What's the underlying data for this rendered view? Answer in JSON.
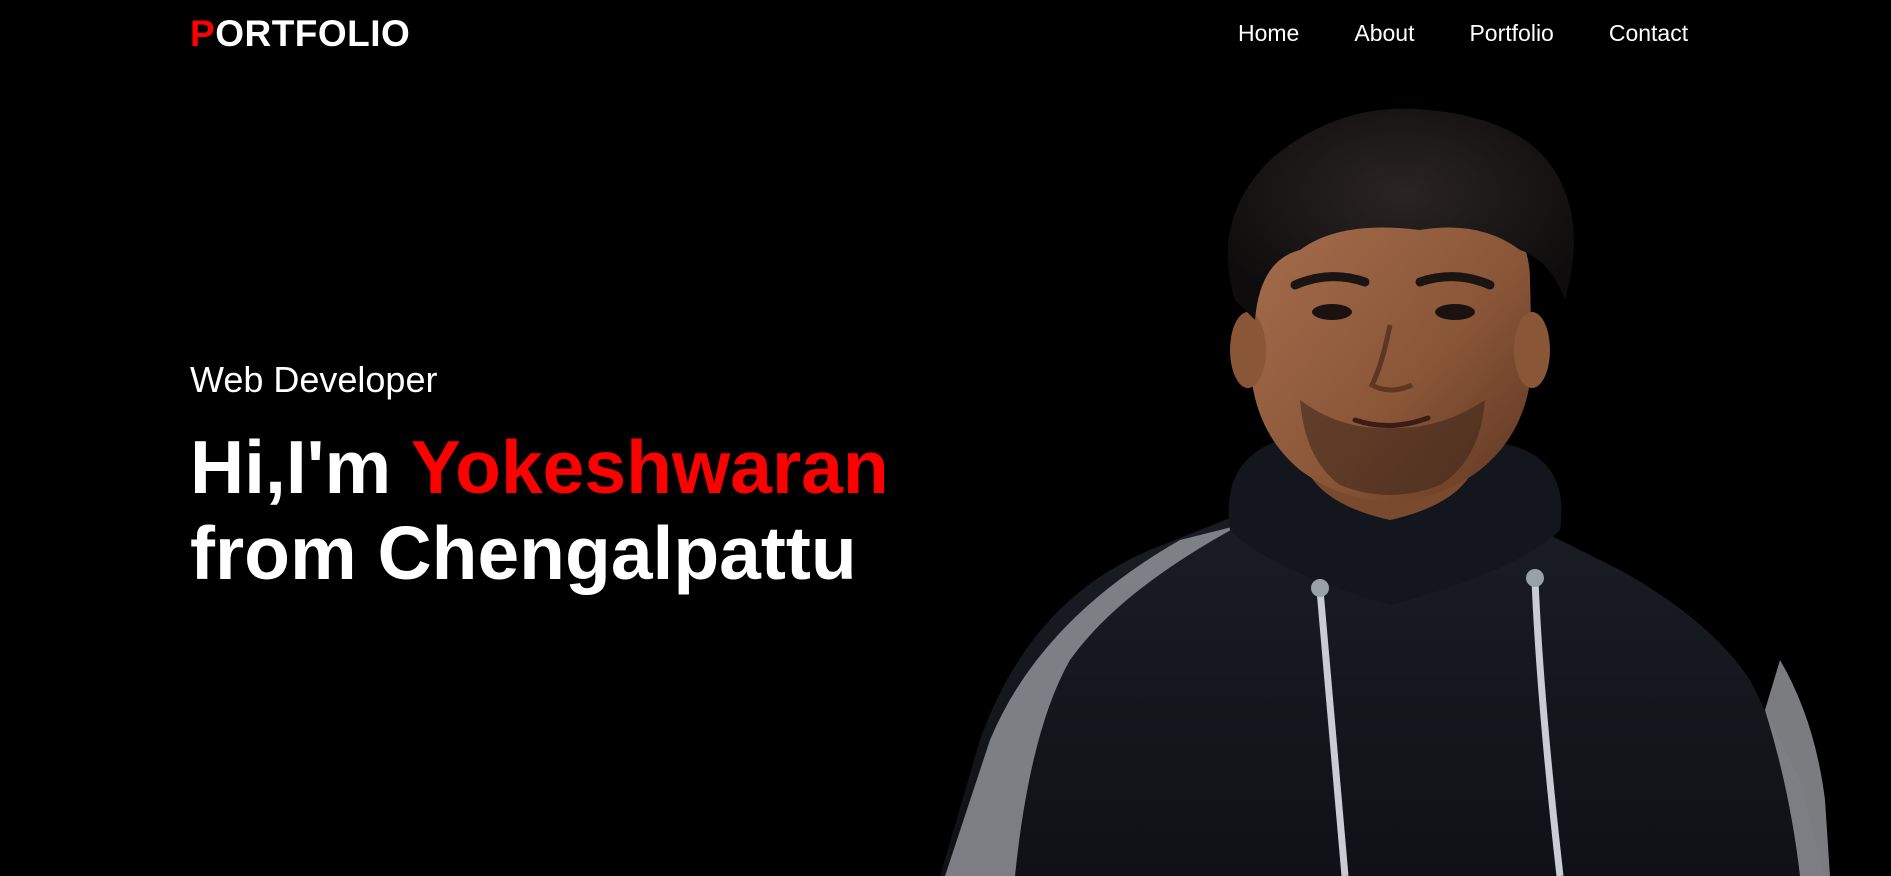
{
  "header": {
    "logo_first_letter": "P",
    "logo_rest": "ORTFOLIO",
    "nav": [
      {
        "label": "Home"
      },
      {
        "label": "About"
      },
      {
        "label": "Portfolio"
      },
      {
        "label": "Contact"
      }
    ]
  },
  "hero": {
    "subtitle": "Web Developer",
    "greeting": "Hi,I'm ",
    "name": "Yokeshwaran",
    "location_line": "from Chengalpattu"
  },
  "colors": {
    "background": "#000000",
    "text": "#ffffff",
    "accent": "#ff0000"
  },
  "icons": {
    "portrait": "person-photo"
  }
}
